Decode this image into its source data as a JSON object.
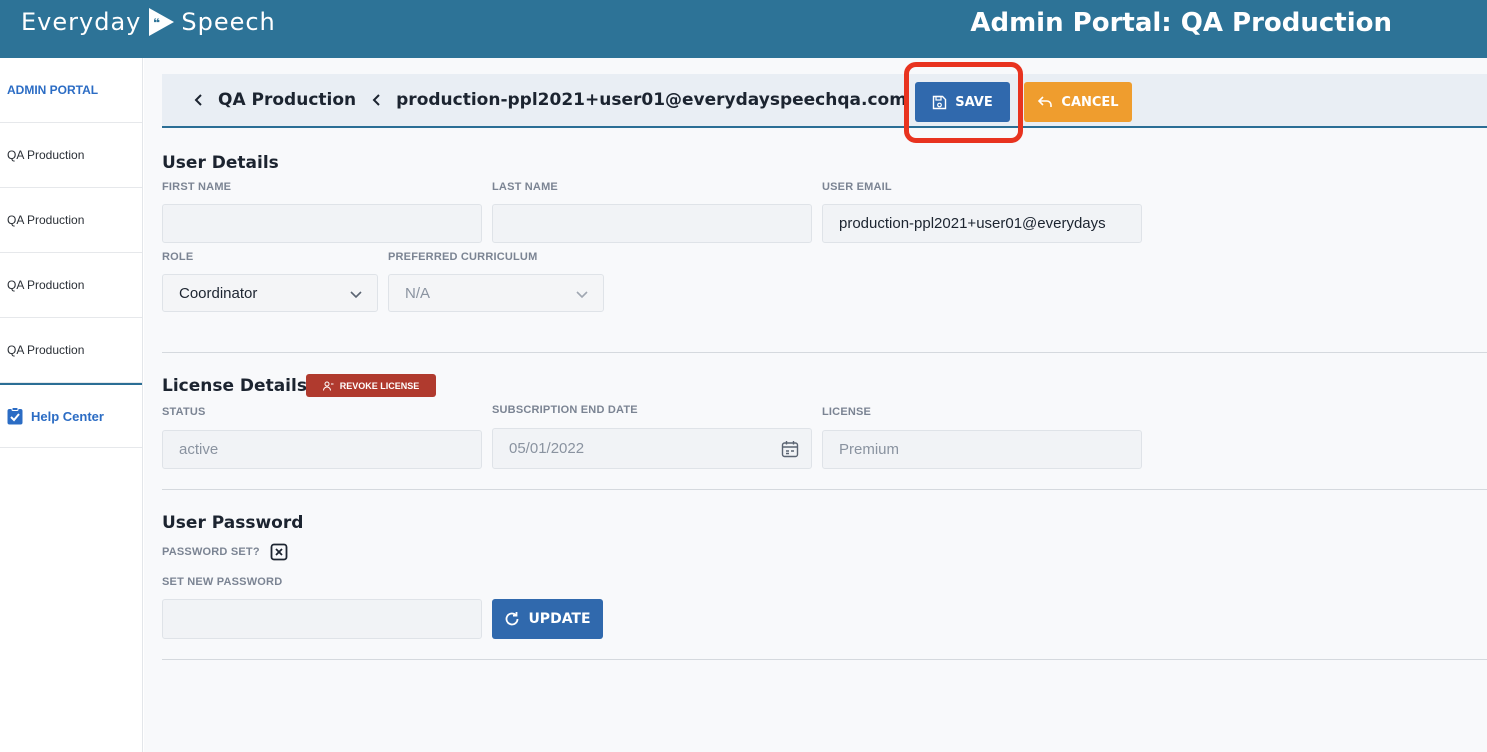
{
  "header": {
    "brand_left": "Everyday",
    "brand_right": "Speech",
    "portal_title": "Admin Portal: QA Production"
  },
  "sidebar": {
    "heading": "ADMIN PORTAL",
    "items": [
      {
        "label": "QA Production"
      },
      {
        "label": "QA Production"
      },
      {
        "label": "QA Production"
      },
      {
        "label": "QA Production"
      }
    ],
    "help_label": "Help Center"
  },
  "breadcrumb": {
    "org": "QA Production",
    "user": "production-ppl2021+user01@everydayspeechqa.com"
  },
  "actions": {
    "save_label": "SAVE",
    "cancel_label": "CANCEL"
  },
  "user_details": {
    "title": "User Details",
    "first_name_label": "FIRST NAME",
    "first_name_value": "",
    "last_name_label": "LAST NAME",
    "last_name_value": "",
    "email_label": "USER EMAIL",
    "email_value": "production-ppl2021+user01@everydays",
    "role_label": "ROLE",
    "role_value": "Coordinator",
    "curriculum_label": "PREFERRED CURRICULUM",
    "curriculum_value": "N/A"
  },
  "license_details": {
    "title": "License Details",
    "revoke_label": "REVOKE LICENSE",
    "status_label": "STATUS",
    "status_value": "active",
    "end_date_label": "SUBSCRIPTION END DATE",
    "end_date_value": "05/01/2022",
    "license_label": "LICENSE",
    "license_value": "Premium"
  },
  "user_password": {
    "title": "User Password",
    "password_set_label": "PASSWORD SET?",
    "new_password_label": "SET NEW PASSWORD",
    "new_password_value": "",
    "update_label": "UPDATE"
  },
  "colors": {
    "topbar": "#2d7397",
    "primary": "#3069ad",
    "cancel": "#ef9d2e",
    "danger": "#b03a2e",
    "highlight": "#e8331f"
  }
}
